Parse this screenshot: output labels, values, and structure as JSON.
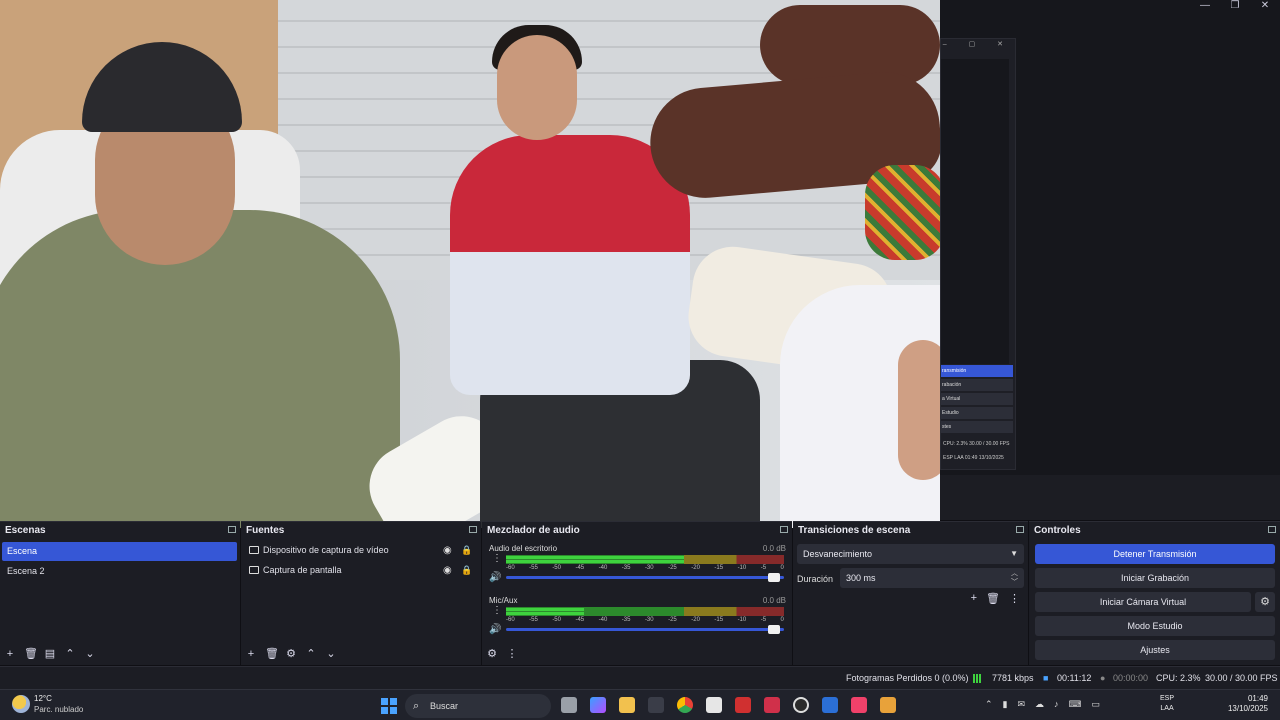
{
  "window": {
    "minimize": "—",
    "maximize": "❐",
    "close": "✕"
  },
  "mini_obs": {
    "controls": [
      "ransmisión",
      "rabación",
      "a Virtual",
      "Estudio",
      "stes"
    ],
    "status1": "CPU: 2.3%   30.00 / 30.00 FPS",
    "status2": "ESP LAA  01:49 13/10/2025"
  },
  "scenes": {
    "title": "Escenas",
    "items": [
      {
        "label": "Escena"
      },
      {
        "label": "Escena 2"
      }
    ]
  },
  "sources": {
    "title": "Fuentes",
    "items": [
      {
        "label": "Dispositivo de captura de vídeo"
      },
      {
        "label": "Captura de pantalla"
      }
    ]
  },
  "mixer": {
    "title": "Mezclador de audio",
    "channels": [
      {
        "name": "Audio del escritorio",
        "db": "0.0 dB",
        "level": 0.64
      },
      {
        "name": "Mic/Aux",
        "db": "0.0 dB",
        "level": 0.28
      }
    ],
    "scale": [
      "-60",
      "-55",
      "-50",
      "-45",
      "-40",
      "-35",
      "-30",
      "-25",
      "-20",
      "-15",
      "-10",
      "-5",
      "0"
    ]
  },
  "transitions": {
    "title": "Transiciones de escena",
    "selected": "Desvanecimiento",
    "duration_label": "Duración",
    "duration_value": "300 ms"
  },
  "controls": {
    "title": "Controles",
    "stop_stream": "Detener Transmisión",
    "start_record": "Iniciar Grabación",
    "start_virtualcam": "Iniciar Cámara Virtual",
    "studio_mode": "Modo Estudio",
    "settings": "Ajustes"
  },
  "status": {
    "dropped": "Fotogramas Perdidos 0 (0.0%)",
    "bitrate": "7781 kbps",
    "stream_time": "00:11:12",
    "rec_time": "00:00:00",
    "cpu": "CPU: 2.3%",
    "fps": "30.00 / 30.00 FPS"
  },
  "taskbar": {
    "temp": "12°C",
    "weather": "Parc. nublado",
    "search_placeholder": "Buscar",
    "lang1": "ESP",
    "lang2": "LAA",
    "time": "01:49",
    "date": "13/10/2025"
  },
  "colors": {
    "accent": "#3657d6",
    "panel": "#1c1d24"
  }
}
